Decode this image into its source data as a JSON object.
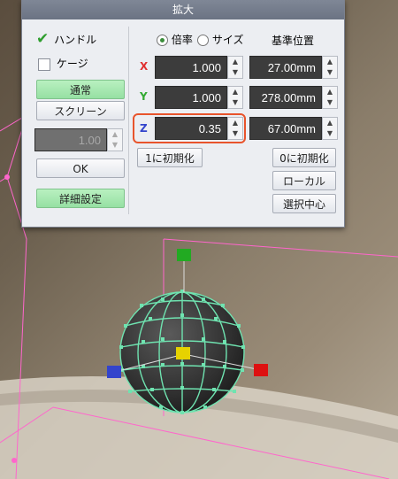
{
  "window": {
    "title": "拡大"
  },
  "left_panel": {
    "handle_label": "ハンドル",
    "handle_checked": true,
    "cage_label": "ケージ",
    "cage_checked": false,
    "mode_normal_label": "通常",
    "mode_screen_label": "スクリーン",
    "amount_value": "1.00",
    "ok_label": "OK",
    "detail_label": "詳細設定"
  },
  "right_panel": {
    "radio_ratio_label": "倍率",
    "radio_size_label": "サイズ",
    "base_position_label": "基準位置",
    "selected_mode": "倍率",
    "rows": [
      {
        "axis": "X",
        "axis_color": "#e03030",
        "scale": "1.000",
        "position": "27.00mm"
      },
      {
        "axis": "Y",
        "axis_color": "#33aa33",
        "scale": "1.000",
        "position": "278.00mm"
      },
      {
        "axis": "Z",
        "axis_color": "#3344cc",
        "scale": "0.35",
        "position": "67.00mm"
      }
    ],
    "reset_one_label": "1に初期化",
    "reset_zero_label": "0に初期化",
    "local_label": "ローカル",
    "select_center_label": "選択中心"
  },
  "colors": {
    "title_bar": "#727a8a",
    "highlight_border": "#e8542c",
    "green_button": "#a6e8b0",
    "mesh_wire": "#6fe3b0",
    "handle_red": "#dd1111",
    "handle_green": "#22aa22",
    "handle_blue": "#3344cc",
    "handle_yellow": "#e6d200"
  }
}
